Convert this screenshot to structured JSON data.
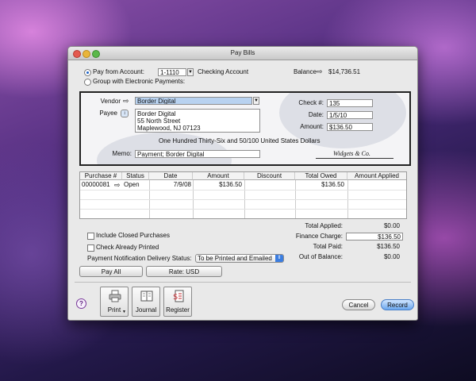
{
  "window": {
    "title": "Pay Bills"
  },
  "top": {
    "pay_from_label": "Pay from Account:",
    "account_number": "1-1110",
    "account_name": "Checking Account",
    "group_label": "Group with Electronic Payments:",
    "balance_label": "Balance",
    "balance_value": "$14,736.51"
  },
  "check": {
    "vendor_label": "Vendor",
    "vendor_value": "Border Digital",
    "payee_label": "Payee",
    "payee_line1": "Border Digital",
    "payee_line2": "55 North Street",
    "payee_line3": "Maplewood, NJ 07123",
    "amount_words": "One Hundred Thirty-Six and 50/100 United States Dollars",
    "memo_label": "Memo:",
    "memo_value": "Payment; Border Digital",
    "check_no_label": "Check #:",
    "check_no_value": "135",
    "date_label": "Date:",
    "date_value": "1/5/10",
    "amount_label": "Amount:",
    "amount_value": "$136.50",
    "signature": "Widgets & Co."
  },
  "table": {
    "headers": [
      "Purchase #",
      "Status",
      "Date",
      "Amount",
      "Discount",
      "Total Owed",
      "Amount Applied"
    ],
    "rows": [
      {
        "purchase": "00000081",
        "status": "Open",
        "date": "7/9/08",
        "amount": "$136.50",
        "discount": "",
        "total_owed": "$136.50",
        "applied": ""
      }
    ]
  },
  "options": {
    "include_closed": "Include Closed Purchases",
    "check_printed": "Check Already Printed",
    "notify_label": "Payment Notification Delivery Status:",
    "notify_value": "To be Printed and Emailed"
  },
  "totals": {
    "total_applied_label": "Total Applied:",
    "total_applied_value": "$0.00",
    "finance_label": "Finance Charge:",
    "finance_value": "$136.50",
    "total_paid_label": "Total Paid:",
    "total_paid_value": "$136.50",
    "out_label": "Out of Balance:",
    "out_value": "$0.00"
  },
  "buttons": {
    "pay_all": "Pay All",
    "rate": "Rate:  USD",
    "print": "Print",
    "journal": "Journal",
    "register": "Register",
    "cancel": "Cancel",
    "record": "Record",
    "help": "?"
  },
  "colors": {
    "accent": "#1d63c8",
    "selection": "#b8d2f0"
  }
}
